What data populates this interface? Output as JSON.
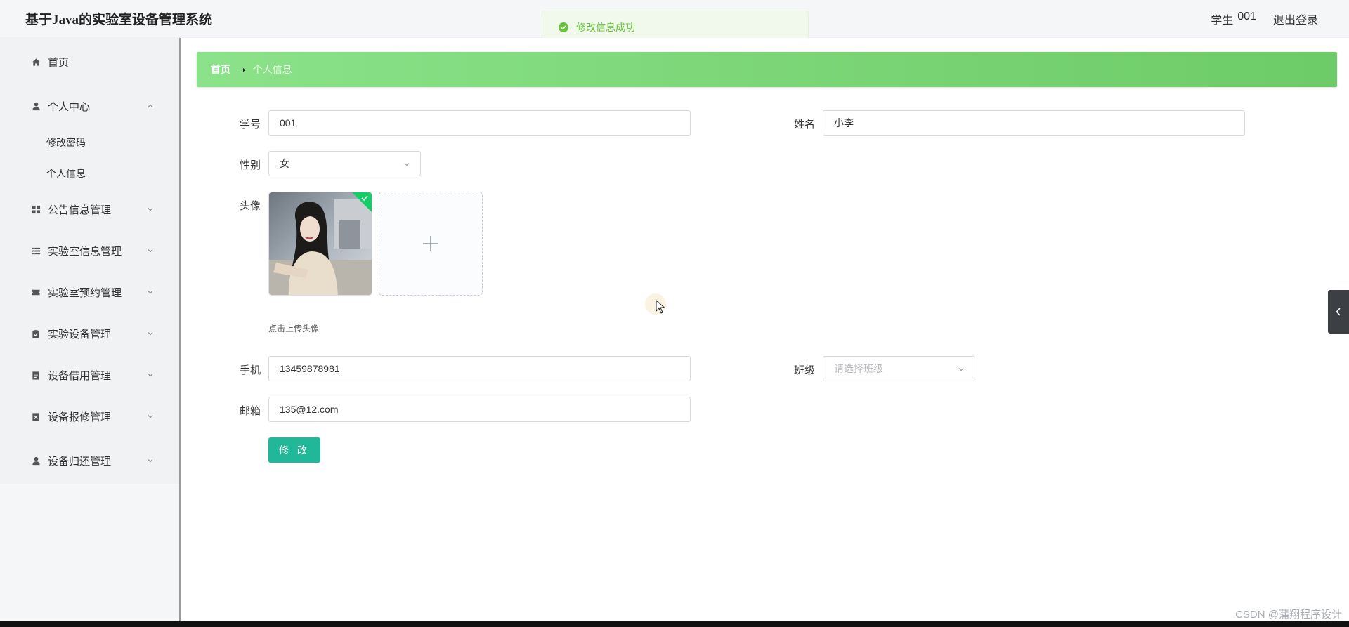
{
  "header": {
    "title": "基于Java的实验室设备管理系统",
    "user_role": "学生",
    "user_name": "001",
    "logout": "退出登录"
  },
  "toast": {
    "message": "修改信息成功",
    "icon": "check-circle-icon"
  },
  "sidebar": {
    "items": [
      {
        "label": "首页",
        "icon": "home-icon"
      },
      {
        "label": "个人中心",
        "icon": "user-icon",
        "expanded": true,
        "children": [
          {
            "label": "修改密码"
          },
          {
            "label": "个人信息"
          }
        ]
      },
      {
        "label": "公告信息管理",
        "icon": "grid-icon"
      },
      {
        "label": "实验室信息管理",
        "icon": "list-icon"
      },
      {
        "label": "实验室预约管理",
        "icon": "ticket-icon"
      },
      {
        "label": "实验设备管理",
        "icon": "clipboard-icon"
      },
      {
        "label": "设备借用管理",
        "icon": "document-icon"
      },
      {
        "label": "设备报修管理",
        "icon": "repair-doc-icon"
      },
      {
        "label": "设备归还管理",
        "icon": "user-icon"
      }
    ]
  },
  "breadcrumb": {
    "home": "首页",
    "separator": "➝",
    "current": "个人信息"
  },
  "form": {
    "student_id": {
      "label": "学号",
      "value": "001"
    },
    "name": {
      "label": "姓名",
      "value": "小李"
    },
    "gender": {
      "label": "性别",
      "value": "女"
    },
    "avatar": {
      "label": "头像",
      "hint": "点击上传头像"
    },
    "phone": {
      "label": "手机",
      "value": "13459878981"
    },
    "class": {
      "label": "班级",
      "placeholder": "请选择班级"
    },
    "email": {
      "label": "邮箱",
      "value": "135@12.com"
    },
    "submit": "修 改"
  },
  "watermark": "CSDN @蒲翔程序设计",
  "colors": {
    "accent": "#20b898",
    "breadcrumb": "#7dd878",
    "toast_text": "#67c23a"
  }
}
